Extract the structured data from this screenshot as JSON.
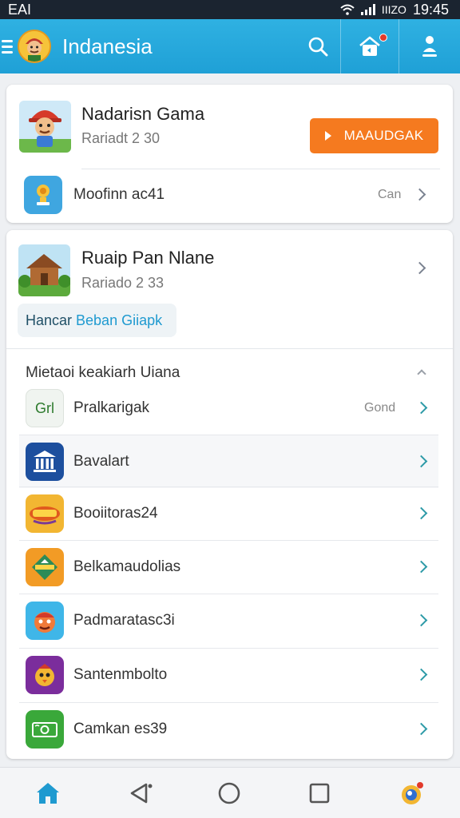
{
  "status_bar": {
    "carrier": "EAI",
    "network": "IIIZO",
    "time": "19:45"
  },
  "app_bar": {
    "title": "Indanesia",
    "icons": [
      "menu-icon",
      "app-avatar",
      "search-icon",
      "home-notification-icon",
      "profile-icon"
    ]
  },
  "featured_card": {
    "game_title": "Nadarisn Gama",
    "game_subtitle": "Rariadt 2 30",
    "action_label": "MAAUDGAK",
    "row_label": "Moofinn ac41",
    "row_meta": "Can"
  },
  "game_card": {
    "game_title": "Ruaip Pan Nlane",
    "game_subtitle": "Rariado 2 33",
    "chip_part1": "Hancar",
    "chip_part2": "Beban Giiapk",
    "section_title": "Mietaoi keakiarh Uiana",
    "items": [
      {
        "icon_text": "Grl",
        "label": "Pralkarigak",
        "meta": "Gond"
      },
      {
        "label": "Bavalart"
      },
      {
        "label": "Booiitoras24"
      },
      {
        "label": "Belkamaudolias"
      },
      {
        "label": "Padmaratasc3i"
      },
      {
        "label": "Santenmbolto"
      },
      {
        "label": "Camkan es39"
      }
    ]
  },
  "colors": {
    "app_bar": "#1fa0d6",
    "accent_orange": "#f57a1f",
    "chevron_teal": "#2d9aa7",
    "nav_home": "#1f9ad0"
  },
  "bottom_nav": {
    "icons": [
      "home-icon",
      "back-icon",
      "home-circle-icon",
      "recents-icon",
      "app-switch-icon"
    ]
  }
}
